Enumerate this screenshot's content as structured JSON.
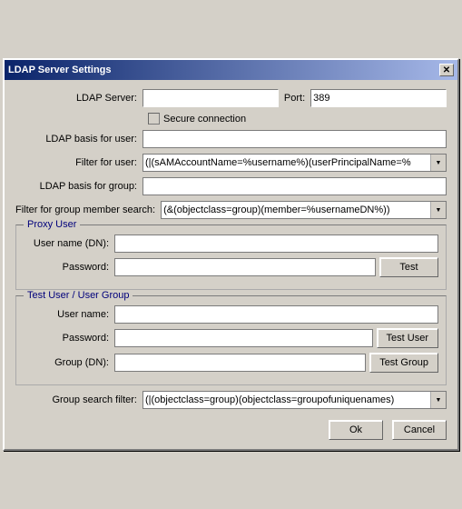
{
  "window": {
    "title": "LDAP Server Settings",
    "close_button": "✕"
  },
  "form": {
    "ldap_server_label": "LDAP Server:",
    "ldap_server_value": "",
    "port_label": "Port:",
    "port_value": "389",
    "secure_label": "Secure connection",
    "ldap_basis_user_label": "LDAP basis for user:",
    "ldap_basis_user_value": "",
    "filter_user_label": "Filter for user:",
    "filter_user_value": "(|(sAMAccountName=%username%)(userPrincipalName=%",
    "ldap_basis_group_label": "LDAP basis for group:",
    "ldap_basis_group_value": "",
    "filter_group_label": "Filter for group member search:",
    "filter_group_value": "(&(objectclass=group)(member=%usernameDN%))",
    "proxy_user_group": "Proxy User",
    "proxy_username_label": "User name (DN):",
    "proxy_username_value": "",
    "proxy_password_label": "Password:",
    "proxy_password_value": "",
    "test_button": "Test",
    "test_user_group": "Test User / User Group",
    "test_username_label": "User name:",
    "test_username_value": "",
    "test_password_label": "Password:",
    "test_password_value": "",
    "test_user_button": "Test User",
    "test_group_label": "Group (DN):",
    "test_group_value": "",
    "test_group_button": "Test Group",
    "group_search_label": "Group search filter:",
    "group_search_value": "(|(objectclass=group)(objectclass=groupofuniquenames)",
    "ok_button": "Ok",
    "cancel_button": "Cancel"
  }
}
